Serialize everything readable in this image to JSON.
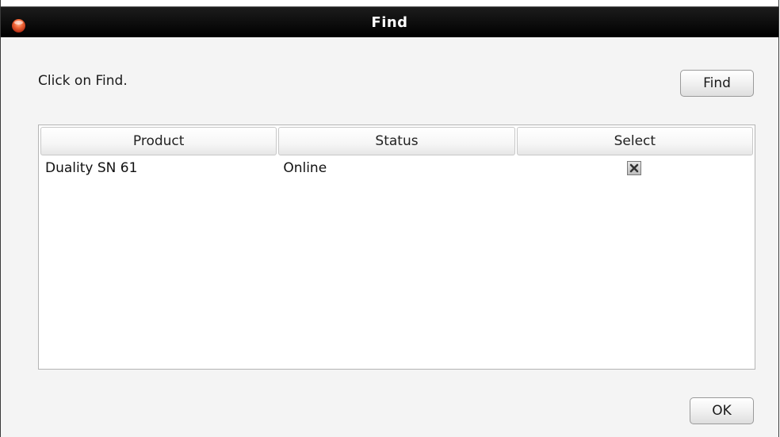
{
  "window": {
    "title": "Find"
  },
  "instruction": "Click on Find.",
  "find_button": "Find",
  "ok_button": "OK",
  "table": {
    "columns": [
      "Product",
      "Status",
      "Select"
    ],
    "rows": [
      {
        "product": "Duality SN 61",
        "status": "Online",
        "selected": true
      }
    ]
  },
  "colors": {
    "titlebar": "#000000",
    "title_text": "#ffffff",
    "close_button": "#e8542a",
    "background": "#f4f4f4"
  },
  "icons": {
    "close": "close-icon",
    "checkbox": "checkbox-checked-icon"
  }
}
